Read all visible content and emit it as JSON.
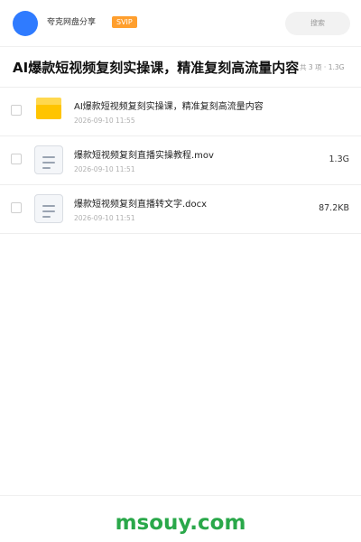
{
  "header": {
    "user_name": "夸克网盘分享",
    "badge": "SVIP",
    "search_placeholder": "搜索"
  },
  "title_row": {
    "title": "AI爆款短视频复刻实操课，精准复刻高流量内容",
    "meta": "共 3 项 · 1.3G"
  },
  "files": [
    {
      "type": "folder",
      "icon": "folder-icon",
      "name": "AI爆款短视频复刻实操课，精准复刻高流量内容",
      "date": "2026-09-10 11:55",
      "size": ""
    },
    {
      "type": "file",
      "icon": "document-icon",
      "name": "爆款短视频复刻直播实操教程.mov",
      "date": "2026-09-10 11:51",
      "size": "1.3G"
    },
    {
      "type": "file",
      "icon": "document-icon",
      "name": "爆款短视频复刻直播转文字.docx",
      "date": "2026-09-10 11:51",
      "size": "87.2KB"
    }
  ],
  "footer": {
    "watermark": "msouy.com"
  },
  "colors": {
    "avatar": "#2f7bff",
    "badge": "#ff9f2e",
    "folder": "#ffc400",
    "watermark": "#2aa84a"
  }
}
